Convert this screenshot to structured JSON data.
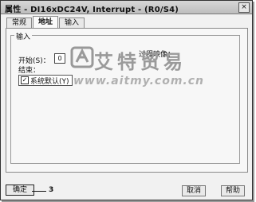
{
  "window": {
    "title": "属性 - DI16xDC24V, Interrupt - (R0/S4)",
    "close_glyph": "×"
  },
  "tabs": [
    {
      "label": "常规",
      "active": false
    },
    {
      "label": "地址",
      "active": true
    },
    {
      "label": "输入",
      "active": false
    }
  ],
  "inputs_group": {
    "title": "输入",
    "start_label": "开始(S)：",
    "start_value": "0",
    "end_label": "结束：",
    "process_image_label": "过程映像：",
    "system_default_label": "系统默认(Y)",
    "system_default_checked": true
  },
  "watermark": {
    "title": "艾特贸易",
    "url": "www.aitmy.com.cn"
  },
  "buttons": {
    "ok": "确定",
    "cancel": "取消",
    "help": "帮助"
  },
  "callout": {
    "number": "3"
  },
  "colors": {
    "titlebar": "#c9c9c9",
    "dialog_bg": "#f1f1f1",
    "watermark": "#9a9a9a"
  }
}
